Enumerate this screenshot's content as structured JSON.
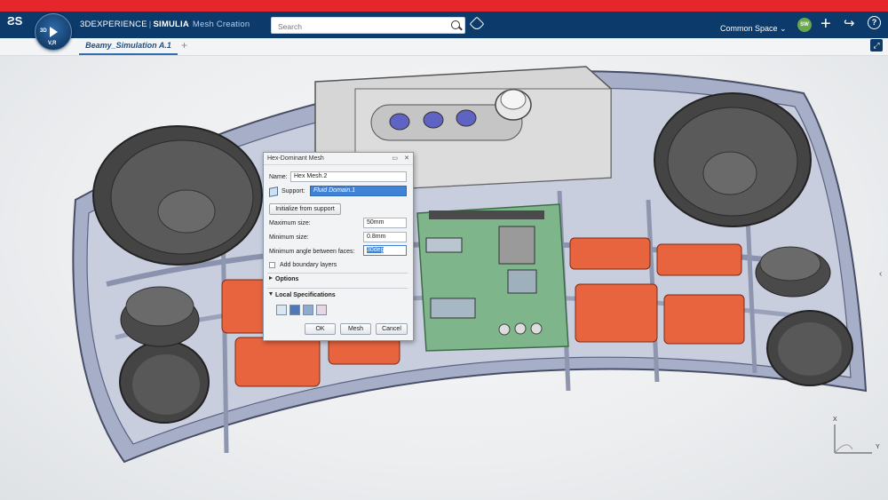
{
  "app": {
    "brand": "3DEXPERIENCE",
    "separator": "|",
    "product": "SIMULIA",
    "module": "Mesh Creation",
    "compass_top": "3D",
    "compass_version": "V,R"
  },
  "search": {
    "placeholder": "Search"
  },
  "header": {
    "space_label": "Common Space",
    "avatar_initials": "SW"
  },
  "tabs": [
    {
      "label": "Beamy_Simulation A.1"
    }
  ],
  "dialog": {
    "title": "Hex-Dominant Mesh",
    "name_label": "Name:",
    "name_value": "Hex Mesh.2",
    "support_label": "Support:",
    "support_value": "Fluid Domain.1",
    "init_button": "Initialize from support",
    "max_size_label": "Maximum size:",
    "max_size_value": "50mm",
    "min_size_label": "Minimum size:",
    "min_size_value": "0.8mm",
    "min_angle_label": "Minimum angle between faces:",
    "min_angle_value": "30deg",
    "boundary_label": "Add boundary layers",
    "options_label": "Options",
    "local_spec_label": "Local Specifications",
    "ok_button": "OK",
    "mesh_button": "Mesh",
    "cancel_button": "Cancel"
  },
  "triad": {
    "x_label": "X",
    "y_label": "Y"
  },
  "colors": {
    "accent": "#0b3a6b",
    "alert_bar": "#e5262b",
    "highlight": "#3f82d6",
    "battery": "#e8643f",
    "pcb": "#7fb58a"
  }
}
